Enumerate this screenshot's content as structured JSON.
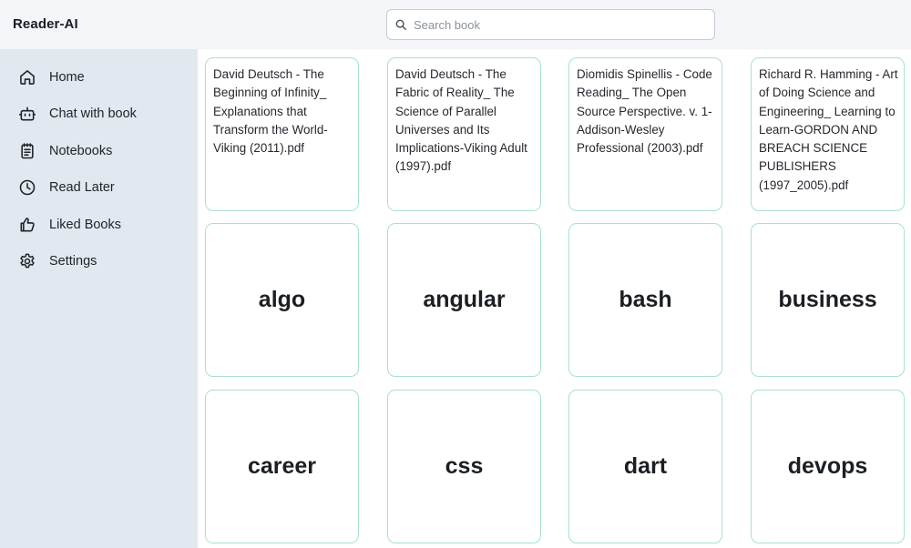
{
  "app": {
    "title": "Reader-AI"
  },
  "search": {
    "placeholder": "Search book",
    "value": ""
  },
  "sidebar": {
    "items": [
      {
        "label": "Home",
        "icon": "home-icon"
      },
      {
        "label": "Chat with book",
        "icon": "robot-icon"
      },
      {
        "label": "Notebooks",
        "icon": "notebook-icon"
      },
      {
        "label": "Read Later",
        "icon": "clock-icon"
      },
      {
        "label": "Liked Books",
        "icon": "thumbs-up-icon"
      },
      {
        "label": "Settings",
        "icon": "gear-icon"
      }
    ]
  },
  "books": [
    {
      "title": "David Deutsch - The Beginning of Infinity_ Explanations that Transform the World-Viking (2011).pdf"
    },
    {
      "title": "David Deutsch - The Fabric of Reality_ The Science of Parallel Universes and Its Implications-Viking Adult (1997).pdf"
    },
    {
      "title": "Diomidis Spinellis - Code Reading_ The Open Source Perspective. v. 1-Addison-Wesley Professional (2003).pdf"
    },
    {
      "title": "Richard R. Hamming - Art of Doing Science and Engineering_ Learning to Learn-GORDON AND BREACH SCIENCE PUBLISHERS (1997_2005).pdf"
    }
  ],
  "categories": [
    {
      "name": "algo"
    },
    {
      "name": "angular"
    },
    {
      "name": "bash"
    },
    {
      "name": "business"
    },
    {
      "name": "career"
    },
    {
      "name": "css"
    },
    {
      "name": "dart"
    },
    {
      "name": "devops"
    }
  ],
  "colors": {
    "sidebar_bg": "#e2e8f0",
    "header_bg": "#f3f5f8",
    "card_border": "#a8e2c9"
  }
}
